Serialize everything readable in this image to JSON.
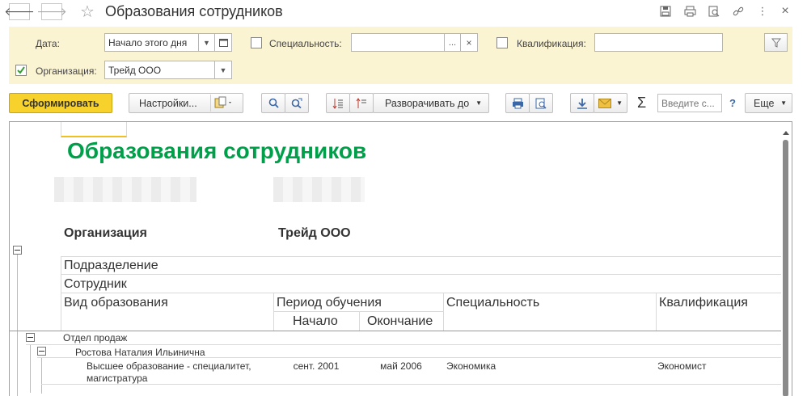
{
  "window": {
    "title": "Образования сотрудников",
    "back_glyph": "🡐",
    "forward_glyph": "🡒",
    "star_glyph": "☆",
    "menu_glyph": "⋮",
    "close_glyph": "×"
  },
  "filters": {
    "date_label": "Дата:",
    "date_value": "Начало этого дня",
    "specialty_label": "Специальность:",
    "specialty_value": "",
    "specialty_dots": "...",
    "specialty_clear": "×",
    "qualification_label": "Квалификация:",
    "qualification_value": "",
    "organization_label": "Организация:",
    "organization_value": "Трейд ООО",
    "organization_checked": true,
    "specialty_checked": false,
    "qualification_checked": false
  },
  "toolbar": {
    "generate_label": "Сформировать",
    "settings_label": "Настройки...",
    "expand_label": "Разворачивать до",
    "search_placeholder": "Введите с...",
    "help_label": "?",
    "more_label": "Еще",
    "sigma_label": "Σ"
  },
  "report": {
    "title": "Образования сотрудников",
    "org_label": "Организация",
    "org_value": "Трейд ООО",
    "headers": {
      "department": "Подразделение",
      "employee": "Сотрудник",
      "education_type": "Вид образования",
      "period": "Период обучения",
      "specialty": "Специальность",
      "qualification": "Квалификация",
      "start": "Начало",
      "end": "Окончание"
    },
    "groups": [
      {
        "department": "Отдел продаж",
        "employees": [
          {
            "name": "Ростова Наталия Ильинична",
            "rows": [
              {
                "education_type": "Высшее образование - специалитет, магистратура",
                "start": "сент. 2001",
                "end": "май 2006",
                "specialty": "Экономика",
                "qualification": "Экономист"
              }
            ]
          }
        ]
      }
    ]
  },
  "colors": {
    "title_green": "#00a04b",
    "filter_bg": "#fbf4d3",
    "generate_bg": "#f7d22c"
  }
}
